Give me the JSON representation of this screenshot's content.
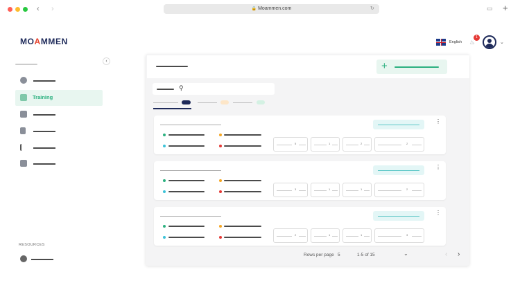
{
  "browser": {
    "url": "Moammen.com",
    "dot_colors": [
      "#ff5f57",
      "#febc2e",
      "#28c840"
    ]
  },
  "brand": {
    "logo_text_a": "MO",
    "logo_text_o": "A",
    "logo_text_b": "MMEN"
  },
  "header": {
    "language": "English",
    "notification_count": "1"
  },
  "sidebar": {
    "collapse_icon": "chevron-left-icon",
    "active_label": "Training",
    "section_resources": "RESOURCES"
  },
  "colors": {
    "accent": "#2bb07f",
    "accent_soft": "#e8f6f0",
    "badge": "#e53935",
    "navy": "#1e2a5a"
  },
  "main": {
    "add_icon": "plus-icon",
    "search_icon": "search-icon",
    "rows": [
      {
        "pill_values": [
          "5",
          "1",
          "2",
          "2"
        ]
      },
      {
        "pill_values": [
          "3",
          "1",
          "1",
          "2"
        ]
      },
      {
        "pill_values": [
          "2",
          "1",
          "1",
          "3"
        ]
      }
    ]
  },
  "pagination": {
    "rows_label": "Rows per page",
    "rows_value": "5",
    "range": "1-5 of 15"
  }
}
